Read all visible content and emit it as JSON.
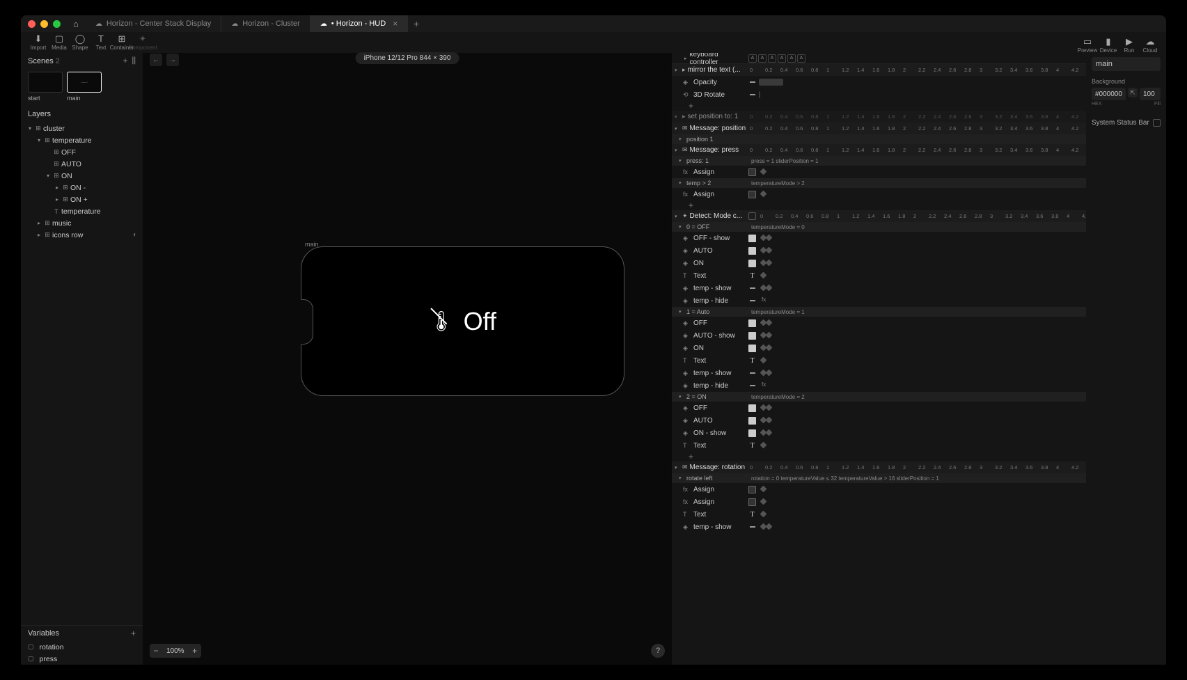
{
  "tabs": [
    {
      "label": "Horizon - Center Stack Display",
      "active": false,
      "dirty": false
    },
    {
      "label": "Horizon - Cluster",
      "active": false,
      "dirty": false
    },
    {
      "label": "Horizon - HUD",
      "active": true,
      "dirty": true
    }
  ],
  "toolbar": [
    {
      "id": "import",
      "label": "Import",
      "icon": "⬇"
    },
    {
      "id": "media",
      "label": "Media",
      "icon": "▢"
    },
    {
      "id": "shape",
      "label": "Shape",
      "icon": "◯"
    },
    {
      "id": "text",
      "label": "Text",
      "icon": "T"
    },
    {
      "id": "container",
      "label": "Container",
      "icon": "⊞"
    },
    {
      "id": "component",
      "label": "Component",
      "icon": "✦",
      "disabled": true
    }
  ],
  "topright": [
    {
      "id": "preview",
      "label": "Preview",
      "icon": "▭"
    },
    {
      "id": "device",
      "label": "Device",
      "icon": "▮"
    },
    {
      "id": "run",
      "label": "Run",
      "icon": "▶"
    },
    {
      "id": "cloud",
      "label": "Cloud",
      "icon": "☁"
    }
  ],
  "deviceInfo": "iPhone 12/12 Pro  844 × 390",
  "scenesHeader": "Scenes",
  "scenesCount": "2",
  "scenes": [
    {
      "name": "start",
      "sel": false
    },
    {
      "name": "main",
      "sel": true
    }
  ],
  "layersHeader": "Layers",
  "layers": [
    {
      "d": 0,
      "arr": "▾",
      "ico": "⊞",
      "name": "cluster"
    },
    {
      "d": 1,
      "arr": "▾",
      "ico": "⊞",
      "name": "temperature"
    },
    {
      "d": 2,
      "arr": "",
      "ico": "⊞",
      "name": "OFF"
    },
    {
      "d": 2,
      "arr": "",
      "ico": "⊞",
      "name": "AUTO"
    },
    {
      "d": 2,
      "arr": "▾",
      "ico": "⊞",
      "name": "ON"
    },
    {
      "d": 3,
      "arr": "▸",
      "ico": "⊞",
      "name": "ON -"
    },
    {
      "d": 3,
      "arr": "▸",
      "ico": "⊞",
      "name": "ON +"
    },
    {
      "d": 2,
      "arr": "",
      "ico": "T",
      "name": "temperature"
    },
    {
      "d": 1,
      "arr": "▸",
      "ico": "⊞",
      "name": "music"
    },
    {
      "d": 1,
      "arr": "▸",
      "ico": "⊞",
      "name": "icons row",
      "vis": "◐"
    }
  ],
  "canvasLabel": "main",
  "canvasText": "Off",
  "zoom": "100%",
  "variablesHeader": "Variables",
  "variables": [
    {
      "name": "rotation"
    },
    {
      "name": "press"
    }
  ],
  "ticks": [
    "0",
    "0.2",
    "0.4",
    "0.6",
    "0.8",
    "1",
    "1.2",
    "1.4",
    "1.6",
    "1.8",
    "2",
    "2.2",
    "2.4",
    "2.6",
    "2.8",
    "3",
    "3.2",
    "3.4",
    "3.6",
    "3.8",
    "4",
    "4.2"
  ],
  "kbHeader": "keyboard controller",
  "kbKeys": [
    "A",
    "A",
    "A",
    "A",
    "A",
    "A"
  ],
  "timeline": [
    {
      "type": "grp",
      "icon": "▸",
      "name": "mirror the text (...",
      "ruler": true
    },
    {
      "type": "row",
      "icon": "◈",
      "name": "Opacity",
      "btn": "dash",
      "bar": [
        0,
        35
      ]
    },
    {
      "type": "row",
      "icon": "⟲",
      "name": "3D Rotate",
      "btn": "dash",
      "bar": [
        0,
        2
      ]
    },
    {
      "type": "add"
    },
    {
      "type": "grp",
      "icon": "▸",
      "name": "set position to: 1",
      "ruler": true,
      "dim": true
    },
    {
      "type": "grp",
      "icon": "✉",
      "name": "Message: position",
      "ruler": true
    },
    {
      "type": "sub",
      "name": "position 1"
    },
    {
      "type": "grp",
      "icon": "✉",
      "name": "Message: press",
      "ruler": true
    },
    {
      "type": "sub",
      "name": "press: 1",
      "note": "press = 1        sliderPosition = 1"
    },
    {
      "type": "row",
      "icon": "fx",
      "name": "Assign",
      "btn": "sq",
      "kf": [
        0
      ]
    },
    {
      "type": "sub",
      "name": "temp > 2",
      "note": "temperatureMode > 2"
    },
    {
      "type": "row",
      "icon": "fx",
      "name": "Assign",
      "btn": "sq",
      "kf": [
        0
      ]
    },
    {
      "type": "add"
    },
    {
      "type": "grp",
      "icon": "✦",
      "name": "Detect: Mode c...",
      "box": true,
      "ruler": true
    },
    {
      "type": "sub",
      "name": "0 = OFF",
      "note": "temperatureMode = 0"
    },
    {
      "type": "row",
      "icon": "◈",
      "name": "OFF - show",
      "btn": "sqf",
      "kf": [
        0,
        8
      ]
    },
    {
      "type": "row",
      "icon": "◈",
      "name": "AUTO",
      "btn": "sqf",
      "kf": [
        0,
        8
      ]
    },
    {
      "type": "row",
      "icon": "◈",
      "name": "ON",
      "btn": "sqf",
      "kf": [
        0,
        8
      ]
    },
    {
      "type": "row",
      "icon": "T",
      "name": "Text",
      "btn": "txt",
      "kf": [
        0
      ]
    },
    {
      "type": "row",
      "icon": "◈",
      "name": "temp - show",
      "btn": "dash",
      "kf": [
        0,
        8
      ]
    },
    {
      "type": "row",
      "icon": "◈",
      "name": "temp - hide",
      "btn": "dash",
      "fx": true
    },
    {
      "type": "sub",
      "name": "1 = Auto",
      "note": "temperatureMode = 1"
    },
    {
      "type": "row",
      "icon": "◈",
      "name": "OFF",
      "btn": "sqf",
      "kf": [
        0,
        8
      ]
    },
    {
      "type": "row",
      "icon": "◈",
      "name": "AUTO - show",
      "btn": "sqf",
      "kf": [
        0,
        8
      ]
    },
    {
      "type": "row",
      "icon": "◈",
      "name": "ON",
      "btn": "sqf",
      "kf": [
        0,
        8
      ]
    },
    {
      "type": "row",
      "icon": "T",
      "name": "Text",
      "btn": "txt",
      "kf": [
        0
      ]
    },
    {
      "type": "row",
      "icon": "◈",
      "name": "temp - show",
      "btn": "dash",
      "kf": [
        0,
        8
      ]
    },
    {
      "type": "row",
      "icon": "◈",
      "name": "temp - hide",
      "btn": "dash",
      "fx": true
    },
    {
      "type": "sub",
      "name": "2 = ON",
      "note": "temperatureMode = 2"
    },
    {
      "type": "row",
      "icon": "◈",
      "name": "OFF",
      "btn": "sqf",
      "kf": [
        0,
        8
      ]
    },
    {
      "type": "row",
      "icon": "◈",
      "name": "AUTO",
      "btn": "sqf",
      "kf": [
        0,
        8
      ]
    },
    {
      "type": "row",
      "icon": "◈",
      "name": "ON - show",
      "btn": "sqf",
      "kf": [
        0,
        8
      ]
    },
    {
      "type": "row",
      "icon": "T",
      "name": "Text",
      "btn": "txt",
      "kf": [
        0
      ]
    },
    {
      "type": "add"
    },
    {
      "type": "grp",
      "icon": "✉",
      "name": "Message: rotation",
      "ruler": true
    },
    {
      "type": "sub",
      "name": "rotate left",
      "note": "rotation = 0     temperatureValue ≤ 32     temperatureValue > 16     sliderPosition = 1"
    },
    {
      "type": "row",
      "icon": "fx",
      "name": "Assign",
      "btn": "sq",
      "kf": [
        0
      ]
    },
    {
      "type": "row",
      "icon": "fx",
      "name": "Assign",
      "btn": "sq",
      "kf": [
        0
      ]
    },
    {
      "type": "row",
      "icon": "T",
      "name": "Text",
      "btn": "txt",
      "kf": [
        0
      ]
    },
    {
      "type": "row",
      "icon": "◈",
      "name": "temp - show",
      "btn": "dash",
      "kf": [
        0,
        8
      ]
    }
  ],
  "inspector": {
    "title": "main",
    "bgLabel": "Background",
    "bgHex": "#000000",
    "bgPct": "100",
    "hexLabel": "HEX",
    "pctLabel": "Fill",
    "ssbLabel": "System Status Bar"
  }
}
